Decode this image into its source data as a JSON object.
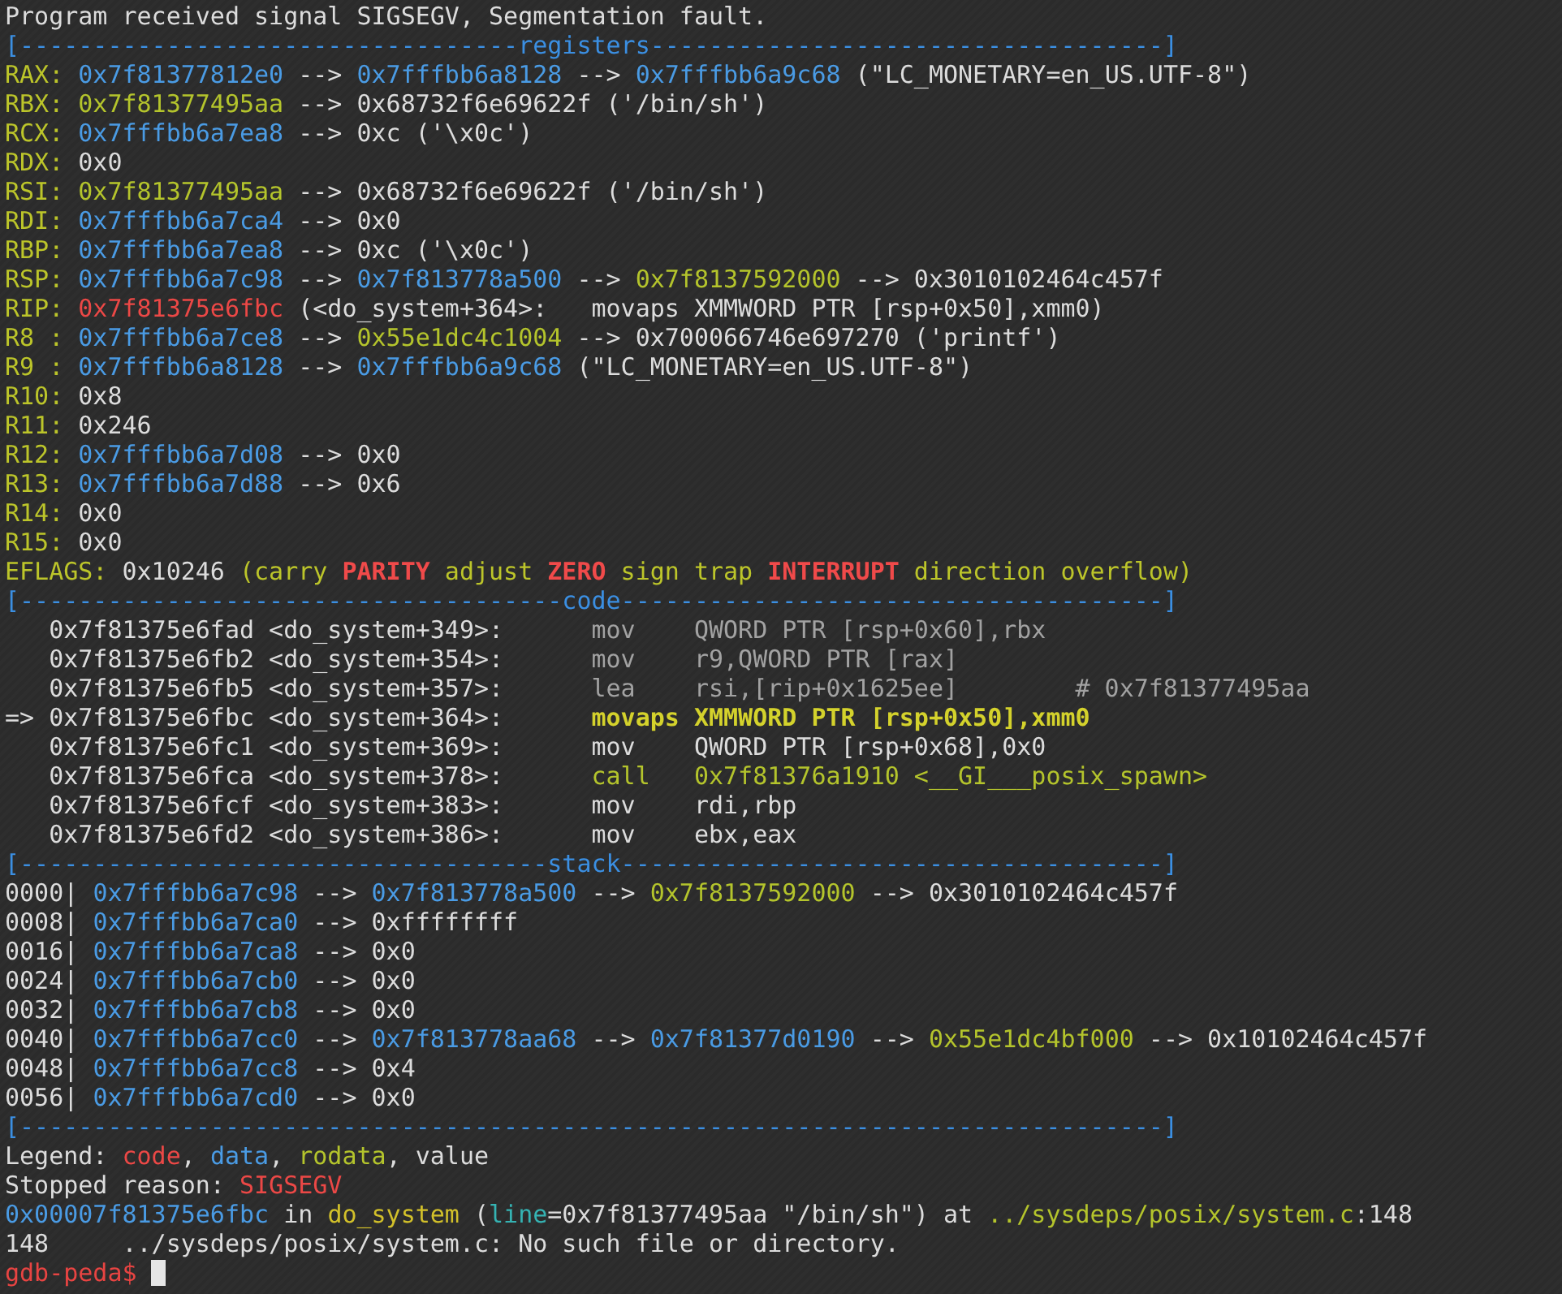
{
  "terminal": {
    "lines": [
      {
        "segments": [
          {
            "text": "Program received signal SIGSEGV, Segmentation fault.",
            "kind": "plain"
          }
        ]
      },
      {
        "segments": [
          {
            "text": "[----------------------------------registers-----------------------------------]",
            "kind": "rule"
          }
        ]
      },
      {
        "segments": [
          {
            "text": "RAX: ",
            "kind": "reg"
          },
          {
            "text": "0x7f81377812e0",
            "kind": "data"
          },
          {
            "text": " --> ",
            "kind": "plain"
          },
          {
            "text": "0x7fffbb6a8128",
            "kind": "data"
          },
          {
            "text": " --> ",
            "kind": "plain"
          },
          {
            "text": "0x7fffbb6a9c68",
            "kind": "data"
          },
          {
            "text": " (\"LC_MONETARY=en_US.UTF-8\")",
            "kind": "plain"
          }
        ]
      },
      {
        "segments": [
          {
            "text": "RBX: ",
            "kind": "reg"
          },
          {
            "text": "0x7f81377495aa",
            "kind": "rodata"
          },
          {
            "text": " --> 0x68732f6e69622f ('/bin/sh')",
            "kind": "plain"
          }
        ]
      },
      {
        "segments": [
          {
            "text": "RCX: ",
            "kind": "reg"
          },
          {
            "text": "0x7fffbb6a7ea8",
            "kind": "data"
          },
          {
            "text": " --> 0xc ('\\x0c')",
            "kind": "plain"
          }
        ]
      },
      {
        "segments": [
          {
            "text": "RDX: ",
            "kind": "reg"
          },
          {
            "text": "0x0",
            "kind": "plain"
          }
        ]
      },
      {
        "segments": [
          {
            "text": "RSI: ",
            "kind": "reg"
          },
          {
            "text": "0x7f81377495aa",
            "kind": "rodata"
          },
          {
            "text": " --> 0x68732f6e69622f ('/bin/sh')",
            "kind": "plain"
          }
        ]
      },
      {
        "segments": [
          {
            "text": "RDI: ",
            "kind": "reg"
          },
          {
            "text": "0x7fffbb6a7ca4",
            "kind": "data"
          },
          {
            "text": " --> 0x0",
            "kind": "plain"
          }
        ]
      },
      {
        "segments": [
          {
            "text": "RBP: ",
            "kind": "reg"
          },
          {
            "text": "0x7fffbb6a7ea8",
            "kind": "data"
          },
          {
            "text": " --> 0xc ('\\x0c')",
            "kind": "plain"
          }
        ]
      },
      {
        "segments": [
          {
            "text": "RSP: ",
            "kind": "reg"
          },
          {
            "text": "0x7fffbb6a7c98",
            "kind": "data"
          },
          {
            "text": " --> ",
            "kind": "plain"
          },
          {
            "text": "0x7f813778a500",
            "kind": "data"
          },
          {
            "text": " --> ",
            "kind": "plain"
          },
          {
            "text": "0x7f8137592000",
            "kind": "rodata"
          },
          {
            "text": " --> 0x3010102464c457f",
            "kind": "plain"
          }
        ]
      },
      {
        "segments": [
          {
            "text": "RIP: ",
            "kind": "reg"
          },
          {
            "text": "0x7f81375e6fbc",
            "kind": "code"
          },
          {
            "text": " (<do_system+364>:   movaps XMMWORD PTR [rsp+0x50],xmm0)",
            "kind": "plain"
          }
        ]
      },
      {
        "segments": [
          {
            "text": "R8 : ",
            "kind": "reg"
          },
          {
            "text": "0x7fffbb6a7ce8",
            "kind": "data"
          },
          {
            "text": " --> ",
            "kind": "plain"
          },
          {
            "text": "0x55e1dc4c1004",
            "kind": "rodata"
          },
          {
            "text": " --> 0x700066746e697270 ('printf')",
            "kind": "plain"
          }
        ]
      },
      {
        "segments": [
          {
            "text": "R9 : ",
            "kind": "reg"
          },
          {
            "text": "0x7fffbb6a8128",
            "kind": "data"
          },
          {
            "text": " --> ",
            "kind": "plain"
          },
          {
            "text": "0x7fffbb6a9c68",
            "kind": "data"
          },
          {
            "text": " (\"LC_MONETARY=en_US.UTF-8\")",
            "kind": "plain"
          }
        ]
      },
      {
        "segments": [
          {
            "text": "R10: ",
            "kind": "reg"
          },
          {
            "text": "0x8",
            "kind": "plain"
          }
        ]
      },
      {
        "segments": [
          {
            "text": "R11: ",
            "kind": "reg"
          },
          {
            "text": "0x246",
            "kind": "plain"
          }
        ]
      },
      {
        "segments": [
          {
            "text": "R12: ",
            "kind": "reg"
          },
          {
            "text": "0x7fffbb6a7d08",
            "kind": "data"
          },
          {
            "text": " --> 0x0",
            "kind": "plain"
          }
        ]
      },
      {
        "segments": [
          {
            "text": "R13: ",
            "kind": "reg"
          },
          {
            "text": "0x7fffbb6a7d88",
            "kind": "data"
          },
          {
            "text": " --> 0x6",
            "kind": "plain"
          }
        ]
      },
      {
        "segments": [
          {
            "text": "R14: ",
            "kind": "reg"
          },
          {
            "text": "0x0",
            "kind": "plain"
          }
        ]
      },
      {
        "segments": [
          {
            "text": "R15: ",
            "kind": "reg"
          },
          {
            "text": "0x0",
            "kind": "plain"
          }
        ]
      },
      {
        "segments": [
          {
            "text": "EFLAGS: ",
            "kind": "reg"
          },
          {
            "text": "0x10246 ",
            "kind": "plain"
          },
          {
            "text": "(carry ",
            "kind": "flag_clear"
          },
          {
            "text": "PARITY",
            "kind": "flag_set"
          },
          {
            "text": " adjust ",
            "kind": "flag_clear"
          },
          {
            "text": "ZERO",
            "kind": "flag_set"
          },
          {
            "text": " sign trap ",
            "kind": "flag_clear"
          },
          {
            "text": "INTERRUPT",
            "kind": "flag_set"
          },
          {
            "text": " direction overflow)",
            "kind": "flag_clear"
          }
        ]
      },
      {
        "segments": [
          {
            "text": "[-------------------------------------code-------------------------------------]",
            "kind": "rule"
          }
        ]
      },
      {
        "segments": [
          {
            "text": "   0x7f81375e6fad <do_system+349>:      ",
            "kind": "plain"
          },
          {
            "text": "mov    QWORD PTR [rsp+0x60],rbx",
            "kind": "dim"
          }
        ]
      },
      {
        "segments": [
          {
            "text": "   0x7f81375e6fb2 <do_system+354>:      ",
            "kind": "plain"
          },
          {
            "text": "mov    r9,QWORD PTR [rax]",
            "kind": "dim"
          }
        ]
      },
      {
        "segments": [
          {
            "text": "   0x7f81375e6fb5 <do_system+357>:      ",
            "kind": "plain"
          },
          {
            "text": "lea    rsi,[rip+0x1625ee]        # 0x7f81377495aa",
            "kind": "dim"
          }
        ]
      },
      {
        "segments": [
          {
            "text": "=> 0x7f81375e6fbc <do_system+364>:      ",
            "kind": "plain"
          },
          {
            "text": "movaps XMMWORD PTR [rsp+0x50],xmm0",
            "kind": "current"
          }
        ]
      },
      {
        "segments": [
          {
            "text": "   0x7f81375e6fc1 <do_system+369>:      mov    QWORD PTR [rsp+0x68],0x0",
            "kind": "plain"
          }
        ]
      },
      {
        "segments": [
          {
            "text": "   0x7f81375e6fca <do_system+378>:      ",
            "kind": "plain"
          },
          {
            "text": "call   0x7f81376a1910 <__GI___posix_spawn>",
            "kind": "rodata"
          }
        ]
      },
      {
        "segments": [
          {
            "text": "   0x7f81375e6fcf <do_system+383>:      mov    rdi,rbp",
            "kind": "plain"
          }
        ]
      },
      {
        "segments": [
          {
            "text": "   0x7f81375e6fd2 <do_system+386>:      mov    ebx,eax",
            "kind": "plain"
          }
        ]
      },
      {
        "segments": [
          {
            "text": "[------------------------------------stack-------------------------------------]",
            "kind": "rule"
          }
        ]
      },
      {
        "segments": [
          {
            "text": "0000| ",
            "kind": "plain"
          },
          {
            "text": "0x7fffbb6a7c98",
            "kind": "data"
          },
          {
            "text": " --> ",
            "kind": "plain"
          },
          {
            "text": "0x7f813778a500",
            "kind": "data"
          },
          {
            "text": " --> ",
            "kind": "plain"
          },
          {
            "text": "0x7f8137592000",
            "kind": "rodata"
          },
          {
            "text": " --> 0x3010102464c457f",
            "kind": "plain"
          }
        ]
      },
      {
        "segments": [
          {
            "text": "0008| ",
            "kind": "plain"
          },
          {
            "text": "0x7fffbb6a7ca0",
            "kind": "data"
          },
          {
            "text": " --> 0xffffffff",
            "kind": "plain"
          }
        ]
      },
      {
        "segments": [
          {
            "text": "0016| ",
            "kind": "plain"
          },
          {
            "text": "0x7fffbb6a7ca8",
            "kind": "data"
          },
          {
            "text": " --> 0x0",
            "kind": "plain"
          }
        ]
      },
      {
        "segments": [
          {
            "text": "0024| ",
            "kind": "plain"
          },
          {
            "text": "0x7fffbb6a7cb0",
            "kind": "data"
          },
          {
            "text": " --> 0x0",
            "kind": "plain"
          }
        ]
      },
      {
        "segments": [
          {
            "text": "0032| ",
            "kind": "plain"
          },
          {
            "text": "0x7fffbb6a7cb8",
            "kind": "data"
          },
          {
            "text": " --> 0x0",
            "kind": "plain"
          }
        ]
      },
      {
        "segments": [
          {
            "text": "0040| ",
            "kind": "plain"
          },
          {
            "text": "0x7fffbb6a7cc0",
            "kind": "data"
          },
          {
            "text": " --> ",
            "kind": "plain"
          },
          {
            "text": "0x7f813778aa68",
            "kind": "data"
          },
          {
            "text": " --> ",
            "kind": "plain"
          },
          {
            "text": "0x7f81377d0190",
            "kind": "data"
          },
          {
            "text": " --> ",
            "kind": "plain"
          },
          {
            "text": "0x55e1dc4bf000",
            "kind": "rodata"
          },
          {
            "text": " --> 0x10102464c457f",
            "kind": "plain"
          }
        ]
      },
      {
        "segments": [
          {
            "text": "0048| ",
            "kind": "plain"
          },
          {
            "text": "0x7fffbb6a7cc8",
            "kind": "data"
          },
          {
            "text": " --> 0x4",
            "kind": "plain"
          }
        ]
      },
      {
        "segments": [
          {
            "text": "0056| ",
            "kind": "plain"
          },
          {
            "text": "0x7fffbb6a7cd0",
            "kind": "data"
          },
          {
            "text": " --> 0x0",
            "kind": "plain"
          }
        ]
      },
      {
        "segments": [
          {
            "text": "[------------------------------------------------------------------------------]",
            "kind": "rule"
          }
        ]
      },
      {
        "segments": [
          {
            "text": "Legend: ",
            "kind": "plain"
          },
          {
            "text": "code",
            "kind": "code"
          },
          {
            "text": ", ",
            "kind": "plain"
          },
          {
            "text": "data",
            "kind": "data"
          },
          {
            "text": ", ",
            "kind": "plain"
          },
          {
            "text": "rodata",
            "kind": "rodata"
          },
          {
            "text": ", value",
            "kind": "plain"
          }
        ]
      },
      {
        "segments": [
          {
            "text": "Stopped reason: ",
            "kind": "plain"
          },
          {
            "text": "SIGSEGV",
            "kind": "code"
          }
        ]
      },
      {
        "segments": [
          {
            "text": "0x00007f81375e6fbc",
            "kind": "data"
          },
          {
            "text": " in ",
            "kind": "plain"
          },
          {
            "text": "do_system",
            "kind": "func"
          },
          {
            "text": " (",
            "kind": "plain"
          },
          {
            "text": "line",
            "kind": "teal"
          },
          {
            "text": "=0x7f81377495aa \"/bin/sh\") at ",
            "kind": "plain"
          },
          {
            "text": "../sysdeps/posix/system.c",
            "kind": "rodata"
          },
          {
            "text": ":148",
            "kind": "plain"
          }
        ]
      },
      {
        "segments": [
          {
            "text": "148     ../sysdeps/posix/system.c: No such file or directory.",
            "kind": "plain"
          }
        ]
      },
      {
        "segments": [
          {
            "text": "gdb-peda$ ",
            "kind": "prompt"
          }
        ],
        "cursor": true
      }
    ]
  }
}
